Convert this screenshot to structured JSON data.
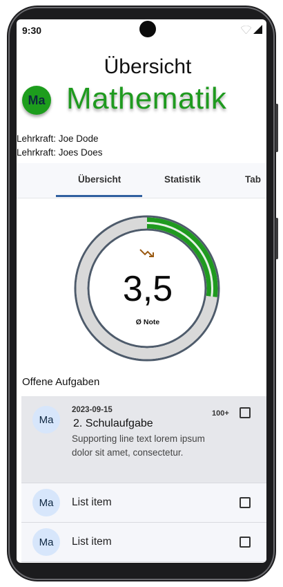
{
  "status": {
    "time": "9:30"
  },
  "header": {
    "title": "Übersicht",
    "subject": "Mathematik",
    "avatar": "Ma"
  },
  "teachers": [
    "Lehrkraft: Joe Dode",
    "Lehrkraft: Joes Does"
  ],
  "tabs": [
    {
      "label": "Übersicht",
      "active": true
    },
    {
      "label": "Statistik",
      "active": false
    },
    {
      "label": "Tab",
      "active": false
    }
  ],
  "grade": {
    "value": "3,5",
    "label": "Ø Note",
    "progress": 0.27,
    "trend_icon": "trending-down-icon"
  },
  "section": {
    "title": "Offene Aufgaben"
  },
  "tasks": [
    {
      "avatar": "Ma",
      "overline": "2023-09-15",
      "headline": "2. Schulaufgabe",
      "supporting": "Supporting line text lorem ipsum dolor sit amet, consectetur.",
      "trailing": "100+",
      "checked": false
    },
    {
      "avatar": "Ma",
      "headline": "List item",
      "checked": false
    },
    {
      "avatar": "Ma",
      "headline": "List item",
      "checked": false
    }
  ],
  "colors": {
    "accent_green": "#1f9a1f",
    "tab_indicator": "#2f5f9f",
    "gauge_track": "#d9d9d9",
    "gauge_border": "#4e5b6b",
    "avatar_bg": "#d7e6fb"
  }
}
